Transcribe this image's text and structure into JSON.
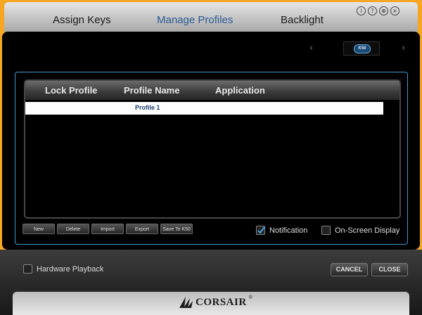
{
  "tabs": [
    {
      "label": "Assign Keys",
      "active": false
    },
    {
      "label": "Manage Profiles",
      "active": true
    },
    {
      "label": "Backlight",
      "active": false
    }
  ],
  "window_icons": [
    "info-icon",
    "help-icon",
    "globe-icon",
    "close-icon"
  ],
  "window_icon_glyphs": {
    "info": "i",
    "help": "?",
    "globe": "⊕",
    "close": "×"
  },
  "device": {
    "badge": "K50",
    "nav_prev": "‹",
    "nav_next": "›"
  },
  "table": {
    "columns": [
      "Lock Profile",
      "Profile Name",
      "Application"
    ],
    "rows": [
      {
        "lock": "",
        "name": "Profile 1",
        "application": ""
      }
    ]
  },
  "actions": {
    "new": "New",
    "delete": "Delete",
    "import": "Import",
    "export": "Export",
    "save_to": "Save To K50"
  },
  "options": {
    "notification": {
      "label": "Notification",
      "checked": true
    },
    "osd": {
      "label": "On-Screen Display",
      "checked": false
    }
  },
  "bottom": {
    "hardware_playback": {
      "label": "Hardware Playback",
      "checked": false
    },
    "cancel": "CANCEL",
    "close": "CLOSE"
  },
  "brand": {
    "name": "CORSAIR",
    "mark": "®"
  },
  "colors": {
    "accent": "#3e9cd6",
    "background": "#f5a623",
    "active_tab": "#2a5a95"
  }
}
